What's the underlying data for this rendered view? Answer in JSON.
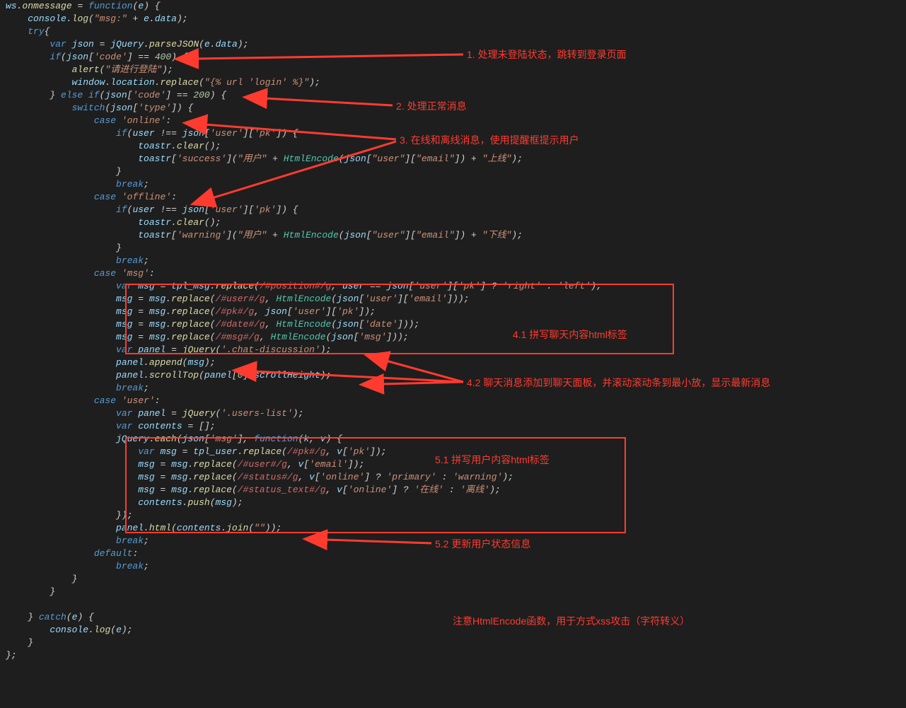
{
  "annotations": {
    "a1": "1. 处理未登陆状态，跳转到登录页面",
    "a2": "2. 处理正常消息",
    "a3": "3. 在线和离线消息，使用提醒框提示用户",
    "a41": "4.1 拼写聊天内容html标签",
    "a42": "4.2 聊天消息添加到聊天面板，并滚动滚动条到最小放，显示最新消息",
    "a51": "5.1 拼写用户内容html标签",
    "a52": "5.2 更新用户状态信息",
    "aXss": "注意HtmlEncode函数，用于方式xss攻击（字符转义）"
  },
  "code": {
    "lines": [
      "ws.onmessage = function(e) {",
      "    console.log(\"msg:\" + e.data);",
      "    try{",
      "        var json = jQuery.parseJSON(e.data);",
      "        if(json['code'] == 400) {",
      "            alert(\"请进行登陆\");",
      "            window.location.replace(\"{% url 'login' %}\");",
      "        } else if(json['code'] == 200) {",
      "            switch(json['type']) {",
      "                case 'online':",
      "                    if(user !== json['user']['pk']) {",
      "                        toastr.clear();",
      "                        toastr['success'](\"用户\" + HtmlEncode(json[\"user\"][\"email\"]) + \"上线\");",
      "                    }",
      "                    break;",
      "                case 'offline':",
      "                    if(user !== json['user']['pk']) {",
      "                        toastr.clear();",
      "                        toastr['warning'](\"用户\" + HtmlEncode(json[\"user\"][\"email\"]) + \"下线\");",
      "                    }",
      "                    break;",
      "                case 'msg':",
      "                    var msg = tpl_msg.replace(/#position#/g, user == json['user']['pk'] ? 'right' : 'left');",
      "                    msg = msg.replace(/#user#/g, HtmlEncode(json['user']['email']));",
      "                    msg = msg.replace(/#pk#/g, json['user']['pk']);",
      "                    msg = msg.replace(/#date#/g, HtmlEncode(json['date']));",
      "                    msg = msg.replace(/#msg#/g, HtmlEncode(json['msg']));",
      "                    var panel = jQuery('.chat-discussion');",
      "                    panel.append(msg);",
      "                    panel.scrollTop(panel[0].scrollHeight);",
      "                    break;",
      "                case 'user':",
      "                    var panel = jQuery('.users-list');",
      "                    var contents = [];",
      "                    jQuery.each(json['msg'], function(k, v) {",
      "                        var msg = tpl_user.replace(/#pk#/g, v['pk']);",
      "                        msg = msg.replace(/#user#/g, v['email']);",
      "                        msg = msg.replace(/#status#/g, v['online'] ? 'primary' : 'warning');",
      "                        msg = msg.replace(/#status_text#/g, v['online'] ? '在线' : '离线');",
      "                        contents.push(msg);",
      "                    });",
      "                    panel.html(contents.join(\"\"));",
      "                    break;",
      "                default:",
      "                    break;",
      "            }",
      "        }",
      "",
      "    } catch(e) {",
      "        console.log(e);",
      "    }",
      "};"
    ]
  }
}
